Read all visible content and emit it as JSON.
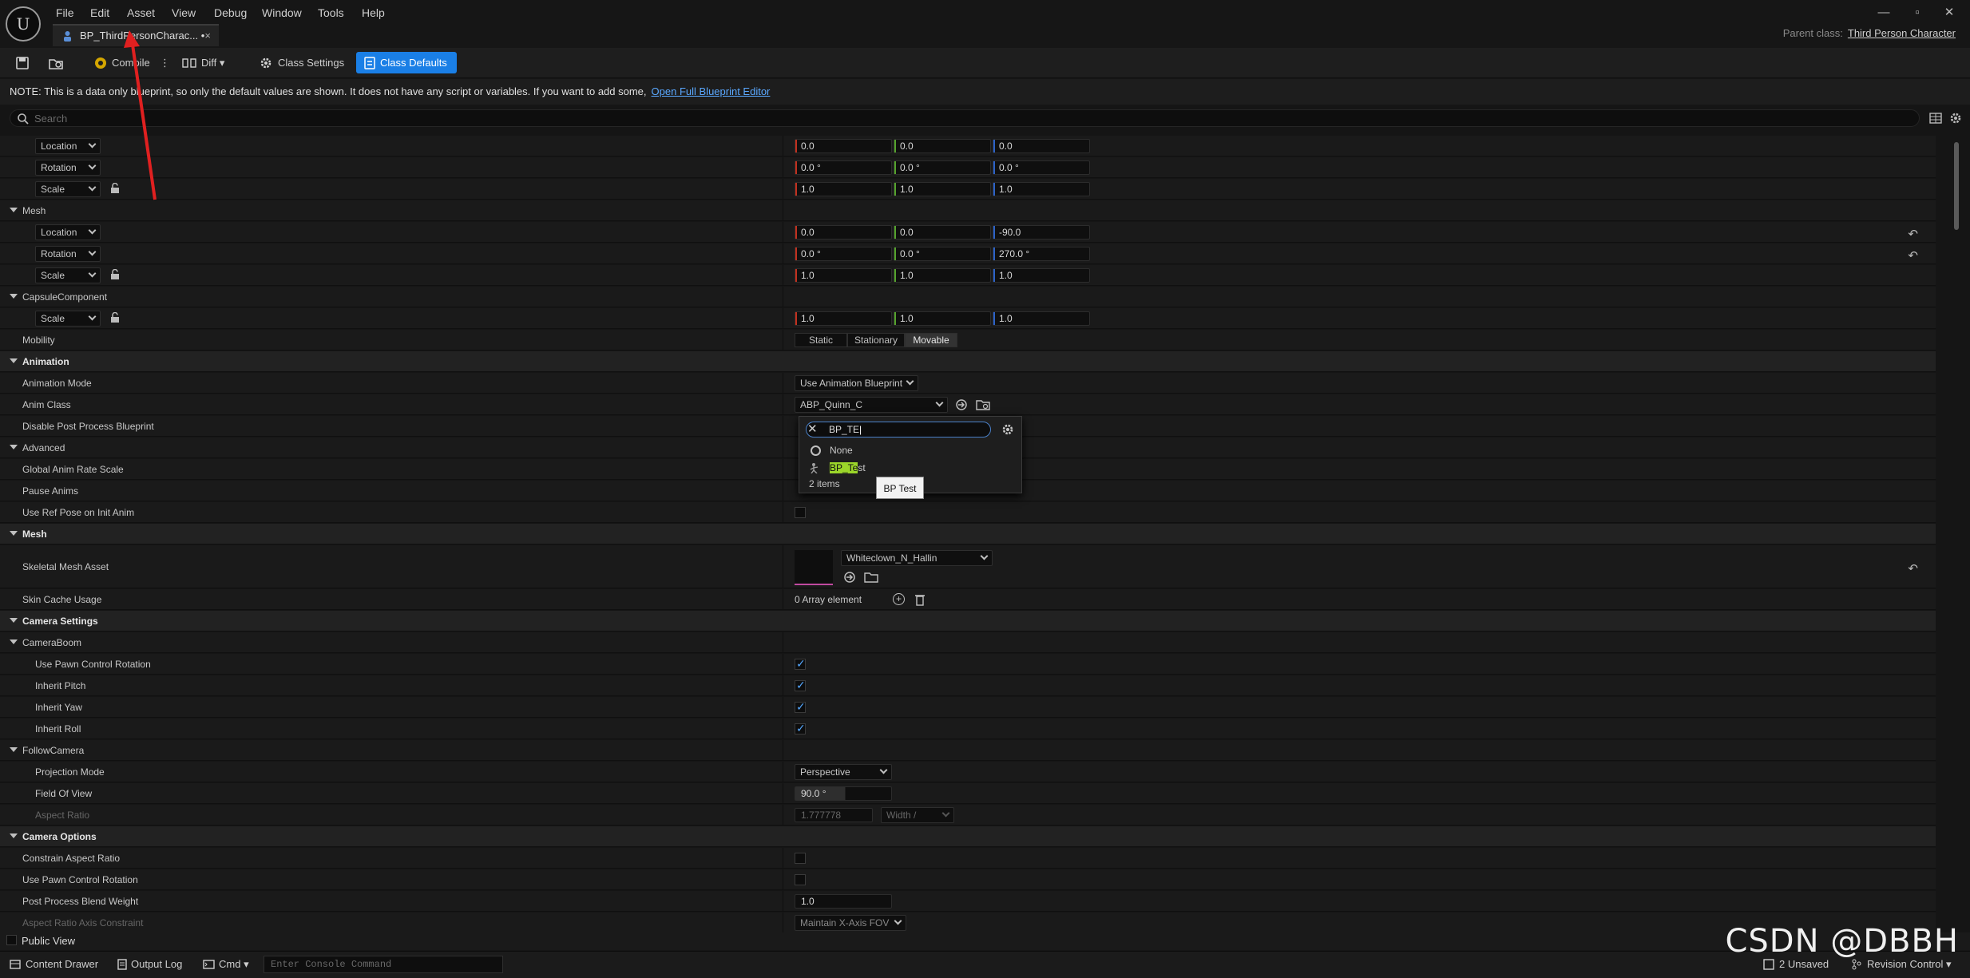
{
  "menu": [
    "File",
    "Edit",
    "Asset",
    "View",
    "Debug",
    "Window",
    "Tools",
    "Help"
  ],
  "tab": {
    "title": "BP_ThirdPersonCharac... •",
    "close": "×"
  },
  "parent_class": {
    "label": "Parent class:",
    "value": "Third Person Character"
  },
  "toolbar": {
    "compile": "Compile",
    "diff": "Diff",
    "class_settings": "Class Settings",
    "class_defaults": "Class Defaults"
  },
  "note": {
    "text": "NOTE: This is a data only blueprint, so only the default values are shown.  It does not have any script or variables.  If you want to add some,",
    "link": "Open Full Blueprint Editor"
  },
  "search": {
    "placeholder": "Search"
  },
  "transform_root": {
    "location": {
      "label": "Location",
      "x": "0.0",
      "y": "0.0",
      "z": "0.0"
    },
    "rotation": {
      "label": "Rotation",
      "x": "0.0 °",
      "y": "0.0 °",
      "z": "0.0 °"
    },
    "scale": {
      "label": "Scale",
      "x": "1.0",
      "y": "1.0",
      "z": "1.0"
    }
  },
  "mesh_transform": {
    "title": "Mesh",
    "location": {
      "label": "Location",
      "x": "0.0",
      "y": "0.0",
      "z": "-90.0"
    },
    "rotation": {
      "label": "Rotation",
      "x": "0.0 °",
      "y": "0.0 °",
      "z": "270.0 °"
    },
    "scale": {
      "label": "Scale",
      "x": "1.0",
      "y": "1.0",
      "z": "1.0"
    }
  },
  "capsule": {
    "title": "CapsuleComponent",
    "scale": {
      "label": "Scale",
      "x": "1.0",
      "y": "1.0",
      "z": "1.0"
    },
    "mobility": {
      "label": "Mobility",
      "options": [
        "Static",
        "Stationary",
        "Movable"
      ],
      "selected": "Movable"
    }
  },
  "animation": {
    "title": "Animation",
    "mode_label": "Animation Mode",
    "mode_value": "Use Animation Blueprint",
    "anim_class_label": "Anim Class",
    "anim_class_value": "ABP_Quinn_C",
    "disable_pp_label": "Disable Post Process Blueprint",
    "advanced_title": "Advanced",
    "global_rate_label": "Global Anim Rate Scale",
    "pause_label": "Pause Anims",
    "ref_pose_label": "Use Ref Pose on Init Anim"
  },
  "popup": {
    "search_value": "BP_TE",
    "none_label": "None",
    "item_highlight": "BP_Te",
    "item_rest": "st",
    "count": "2 items",
    "tooltip": "BP Test"
  },
  "mesh": {
    "title": "Mesh",
    "skeletal_label": "Skeletal Mesh Asset",
    "skeletal_value": "Whiteclown_N_Hallin",
    "skin_cache_label": "Skin Cache Usage",
    "skin_cache_value": "0 Array element"
  },
  "camera_settings": {
    "title": "Camera Settings",
    "boom_title": "CameraBoom",
    "pawn_rot_label": "Use Pawn Control Rotation",
    "pitch_label": "Inherit Pitch",
    "yaw_label": "Inherit Yaw",
    "roll_label": "Inherit Roll",
    "follow_title": "FollowCamera",
    "projection_label": "Projection Mode",
    "projection_value": "Perspective",
    "fov_label": "Field Of View",
    "fov_value": "90.0 °",
    "aspect_label": "Aspect Ratio",
    "aspect_value": "1.777778",
    "aspect_preset": "Width /"
  },
  "camera_options": {
    "title": "Camera Options",
    "constrain_label": "Constrain Aspect Ratio",
    "pawn_rot_label": "Use Pawn Control Rotation",
    "blend_label": "Post Process Blend Weight",
    "blend_value": "1.0",
    "axis_label": "Aspect Ratio Axis Constraint",
    "axis_value": "Maintain X-Axis FOV"
  },
  "public_view": "Public View",
  "statusbar": {
    "content_drawer": "Content Drawer",
    "output_log": "Output Log",
    "cmd": "Cmd",
    "console_placeholder": "Enter Console Command",
    "unsaved": "2 Unsaved",
    "revision": "Revision Control"
  },
  "watermark": "CSDN @DBBH",
  "colors": {
    "accent": "#1a7fe6",
    "highlight": "#9bd52a",
    "arrow": "#e02020"
  }
}
